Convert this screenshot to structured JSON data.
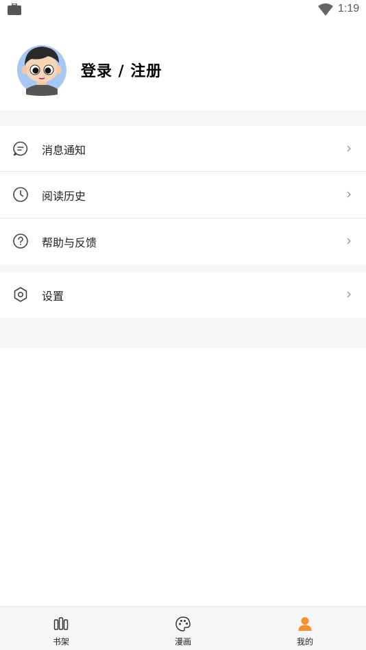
{
  "status_bar": {
    "time": "1:19"
  },
  "profile": {
    "login_label": "登录 / 注册"
  },
  "menu": {
    "items": [
      {
        "label": "消息通知",
        "icon": "message-icon"
      },
      {
        "label": "阅读历史",
        "icon": "clock-icon"
      },
      {
        "label": "帮助与反馈",
        "icon": "help-icon"
      },
      {
        "label": "设置",
        "icon": "settings-icon"
      }
    ]
  },
  "tab_bar": {
    "tabs": [
      {
        "label": "书架",
        "icon": "bookshelf-icon",
        "active": false
      },
      {
        "label": "漫画",
        "icon": "palette-icon",
        "active": false
      },
      {
        "label": "我的",
        "icon": "person-icon",
        "active": true
      }
    ]
  },
  "colors": {
    "accent": "#f5922f",
    "background_gap": "#f5f6f8",
    "text": "#222222"
  }
}
